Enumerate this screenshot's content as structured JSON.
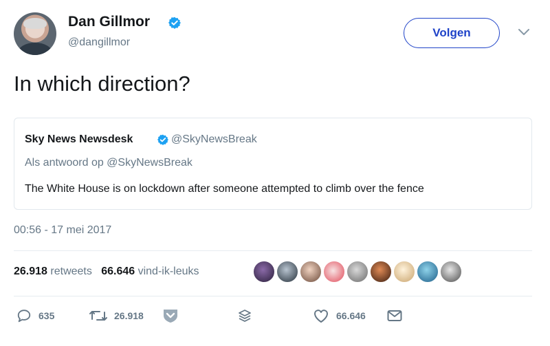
{
  "author": {
    "name": "Dan Gillmor",
    "handle": "@dangillmor",
    "verified": true
  },
  "follow_button_label": "Volgen",
  "tweet_text": "In which direction?",
  "quoted_tweet": {
    "name": "Sky News Newsdesk",
    "handle": "@SkyNewsBreak",
    "reply_to": "Als antwoord op @SkyNewsBreak",
    "text": "The White House is on lockdown after someone attempted to climb over the fence"
  },
  "timestamp": "00:56 - 17 mei 2017",
  "stats": {
    "retweets_count": "26.918",
    "retweets_label": "retweets",
    "likes_count": "66.646",
    "likes_label": "vind-ik-leuks"
  },
  "actions": {
    "replies": "635",
    "retweets": "26.918",
    "likes": "66.646"
  },
  "colors": {
    "accent": "#1f43c8",
    "verified": "#1da1f2",
    "muted": "#657786",
    "text": "#14171a"
  },
  "icons": [
    "verified-badge-icon",
    "chevron-down-icon",
    "reply-icon",
    "retweet-icon",
    "shield-icon",
    "stack-icon",
    "heart-icon",
    "envelope-icon"
  ]
}
